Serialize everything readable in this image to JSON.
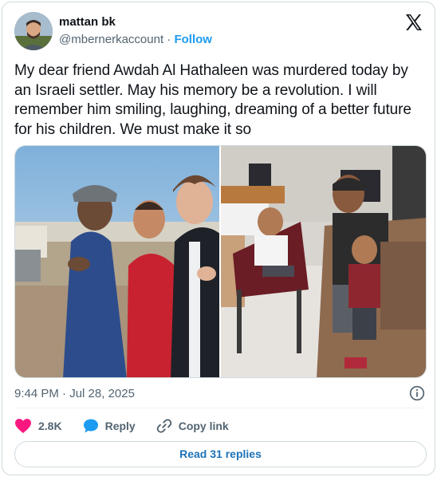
{
  "author": {
    "name": "mattan bk",
    "handle": "@mbernerkaccount",
    "separator": "·",
    "follow_label": "Follow"
  },
  "tweet": {
    "text": "My dear friend Awdah Al Hathaleen was murdered today by an Israeli settler. May his memory be a revolution. I will remember him smiling, laughing, dreaming of a better future for his children. We must make it so"
  },
  "media": {
    "photos": [
      {
        "subject": "man-in-cap-holding-child-with-friend-outdoors"
      },
      {
        "subject": "children-on-chair-with-man-in-office"
      }
    ]
  },
  "meta": {
    "time": "9:44 PM",
    "date_separator": "·",
    "date": "Jul 28, 2025"
  },
  "actions": {
    "likes": "2.8K",
    "reply_label": "Reply",
    "copy_link_label": "Copy link"
  },
  "footer": {
    "read_replies_label": "Read 31 replies"
  },
  "colors": {
    "like": "#f91880",
    "reply": "#1d9bf0",
    "link": "#1d9bf0",
    "text": "#0f1419",
    "secondary": "#536471",
    "border": "#cfd9de"
  },
  "icons": {
    "brand": "x-logo-icon",
    "info": "info-icon",
    "like": "heart-icon",
    "reply": "speech-bubble-icon",
    "copy": "link-icon"
  }
}
